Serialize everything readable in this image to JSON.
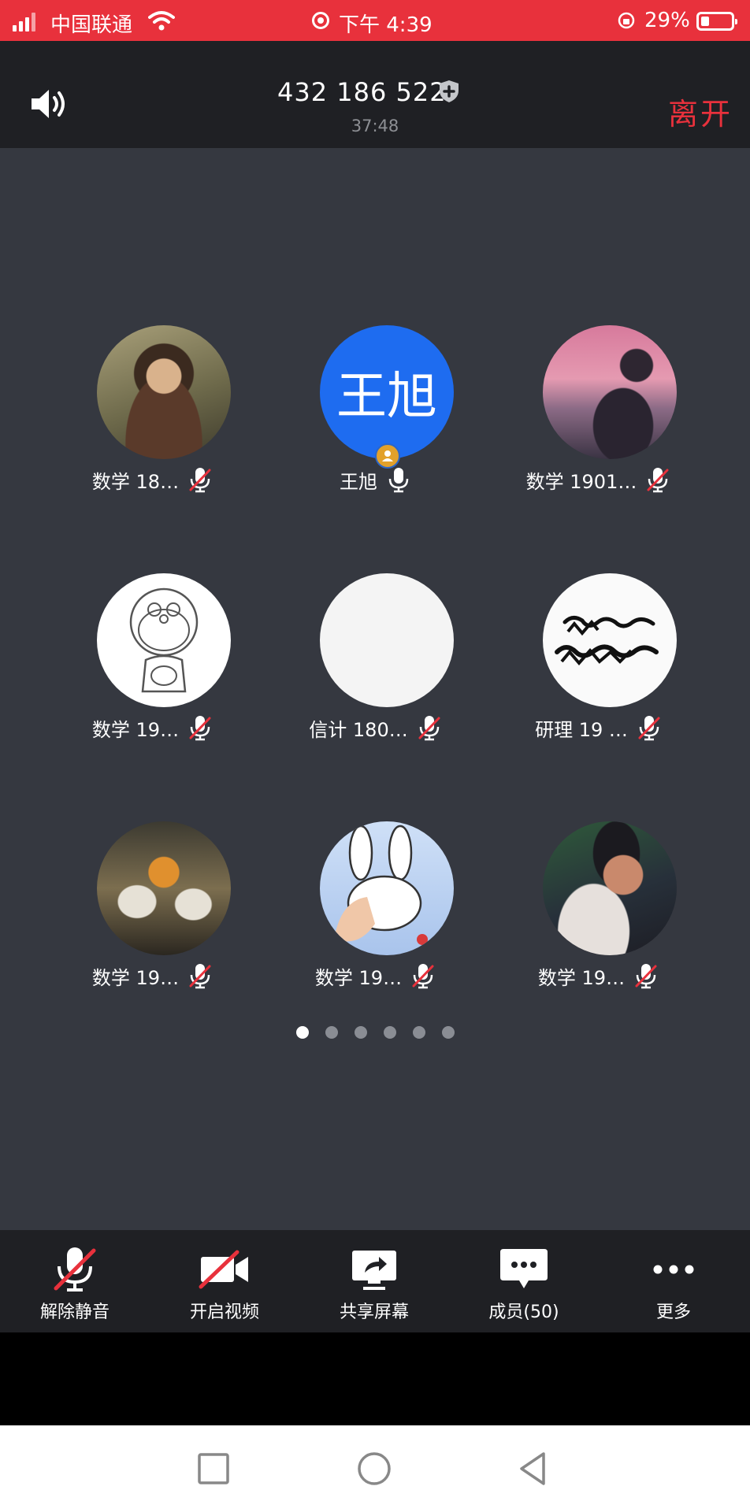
{
  "status_bar": {
    "carrier": "中国联通",
    "time": "下午 4:39",
    "battery_percent": "29%"
  },
  "meeting": {
    "meeting_id": "432 186 522",
    "duration": "37:48",
    "leave_label": "离开"
  },
  "participants": [
    {
      "name": "数学 18…",
      "avatar": "painting-girl-photo",
      "mic": "muted"
    },
    {
      "name": "王旭",
      "avatar_text": "王旭",
      "avatar_color": "#1e6cf0",
      "mic": "on",
      "host": true
    },
    {
      "name": "数学 1901…",
      "avatar": "sunset-couple-photo",
      "mic": "muted"
    },
    {
      "name": "数学 19…",
      "avatar": "doraemon-sketch",
      "mic": "muted"
    },
    {
      "name": "信计 180…",
      "avatar": "blank-white",
      "mic": "muted"
    },
    {
      "name": "研理 19 …",
      "avatar": "calligraphy-image",
      "mic": "muted"
    },
    {
      "name": "数学 19…",
      "avatar": "cranes-painting",
      "mic": "muted"
    },
    {
      "name": "数学 19…",
      "avatar": "bunny-hand-photo",
      "mic": "muted"
    },
    {
      "name": "数学 19…",
      "avatar": "sunglasses-man-photo",
      "mic": "muted"
    }
  ],
  "pagination": {
    "total_pages": 6,
    "current_page": 1
  },
  "toolbar": {
    "unmute_label": "解除静音",
    "video_label": "开启视频",
    "share_label": "共享屏幕",
    "members_label": "成员(50)",
    "more_label": "更多"
  },
  "colors": {
    "status_bar": "#e8313c",
    "leave_text": "#e8313c",
    "grid_background": "#353840",
    "bar_background": "#1f2024",
    "host_avatar": "#1e6cf0"
  }
}
